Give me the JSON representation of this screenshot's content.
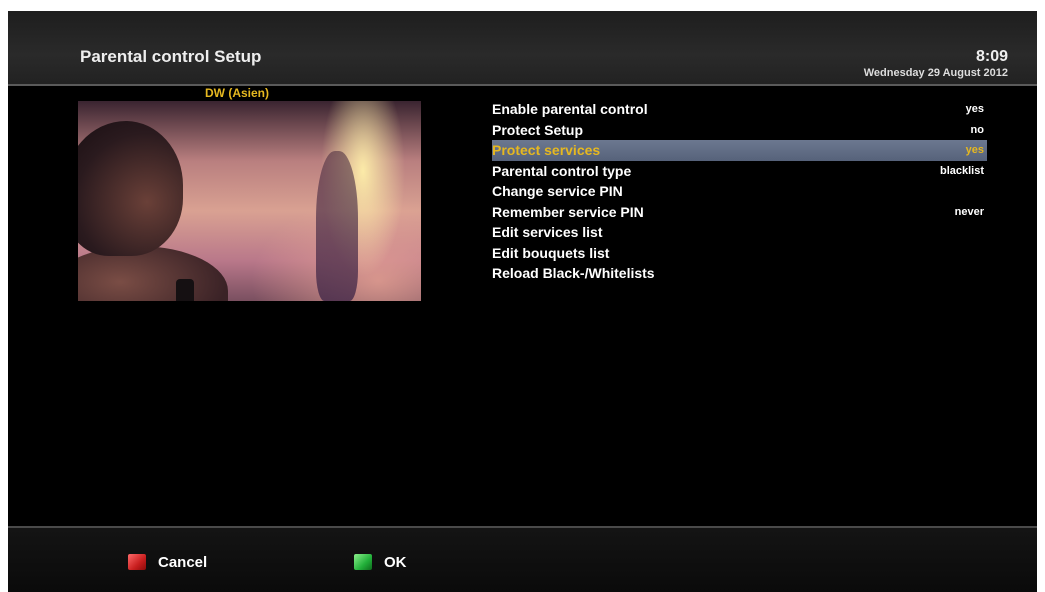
{
  "header": {
    "title": "Parental control Setup",
    "time": "8:09",
    "date": "Wednesday 29 August 2012"
  },
  "preview": {
    "channel": "DW (Asien)"
  },
  "menu": {
    "items": [
      {
        "label": "Enable parental control",
        "value": "yes"
      },
      {
        "label": "Protect Setup",
        "value": "no"
      },
      {
        "label": "Protect services",
        "value": "yes",
        "selected": true
      },
      {
        "label": "Parental control type",
        "value": "blacklist"
      },
      {
        "label": "Change service PIN",
        "value": ""
      },
      {
        "label": "Remember service PIN",
        "value": "never"
      },
      {
        "label": "Edit services list",
        "value": ""
      },
      {
        "label": "Edit bouquets list",
        "value": ""
      },
      {
        "label": "Reload Black-/Whitelists",
        "value": ""
      }
    ]
  },
  "footer": {
    "cancel": {
      "label": "Cancel",
      "color": "red"
    },
    "ok": {
      "label": "OK",
      "color": "green"
    }
  },
  "colors": {
    "background": "#000000",
    "highlight": "#e6b820",
    "selection_bar": "#6c7890"
  }
}
